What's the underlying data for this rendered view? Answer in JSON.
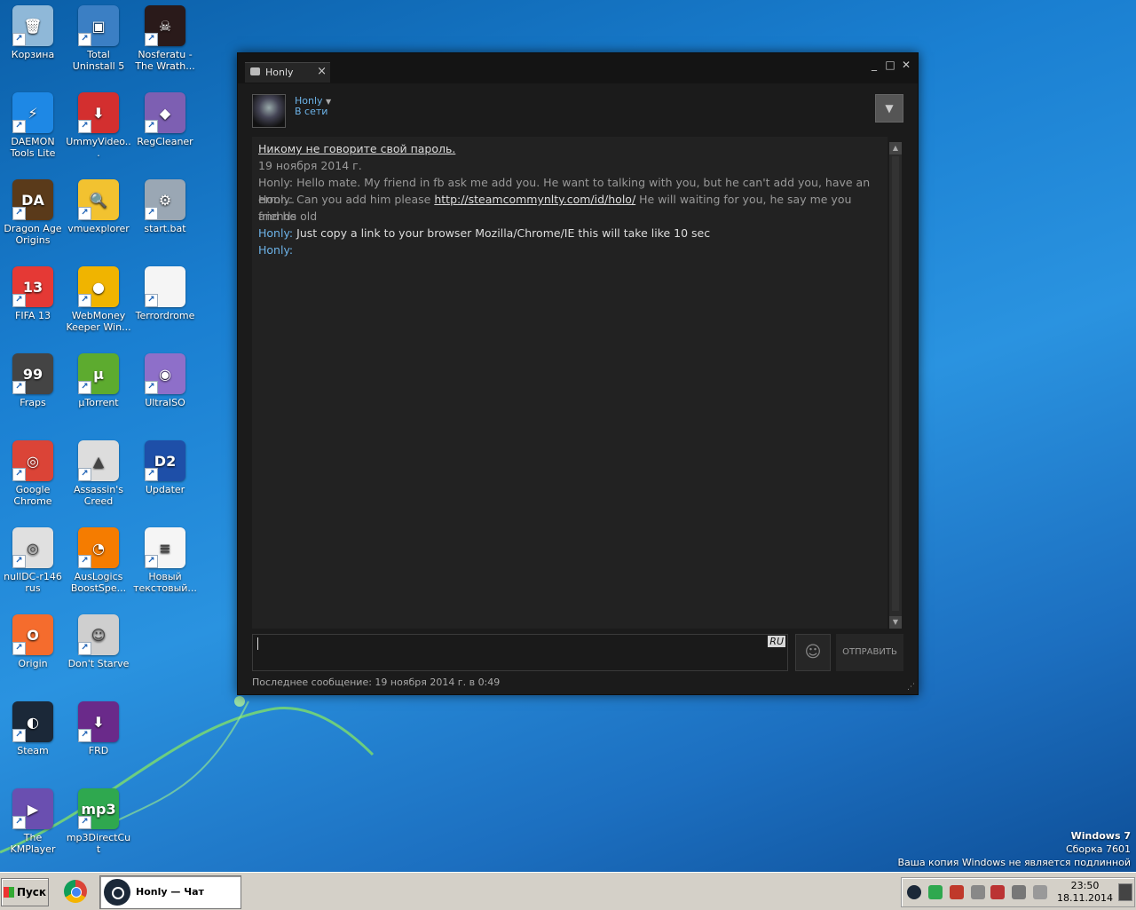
{
  "desktop": {
    "icons": [
      {
        "label": "Корзина",
        "icon": "recycle-bin-icon",
        "color": "#8fb8d8",
        "glyph": "🗑"
      },
      {
        "label": "Total Uninstall 5",
        "icon": "total-uninstall-icon",
        "color": "#3b7fc4",
        "glyph": "▣"
      },
      {
        "label": "Nosferatu - The Wrath...",
        "icon": "nosferatu-icon",
        "color": "#2a1a1a",
        "glyph": "☠"
      },
      {
        "label": "DAEMON Tools Lite",
        "icon": "daemon-tools-icon",
        "color": "#1e88e5",
        "glyph": "⚡"
      },
      {
        "label": "UmmyVideo...",
        "icon": "ummy-video-icon",
        "color": "#d32f2f",
        "glyph": "⬇"
      },
      {
        "label": "RegCleaner",
        "icon": "regcleaner-icon",
        "color": "#7d5fb2",
        "glyph": "◆"
      },
      {
        "label": "Dragon Age Origins",
        "icon": "dragon-age-icon",
        "color": "#5a3a1a",
        "glyph": "DA"
      },
      {
        "label": "vmuexplorer",
        "icon": "vmuexplorer-icon",
        "color": "#f2c230",
        "glyph": "🔍"
      },
      {
        "label": "start.bat",
        "icon": "bat-file-icon",
        "color": "#9aa7b4",
        "glyph": "⚙"
      },
      {
        "label": "FIFA 13",
        "icon": "fifa13-icon",
        "color": "#e53935",
        "glyph": "13"
      },
      {
        "label": "WebMoney Keeper Win...",
        "icon": "webmoney-icon",
        "color": "#f0b400",
        "glyph": "●"
      },
      {
        "label": "Terrordrome",
        "icon": "blank-file-icon",
        "color": "#f5f5f5",
        "glyph": ""
      },
      {
        "label": "Fraps",
        "icon": "fraps-icon",
        "color": "#444444",
        "glyph": "99"
      },
      {
        "label": "µTorrent",
        "icon": "utorrent-icon",
        "color": "#5dab2f",
        "glyph": "µ"
      },
      {
        "label": "UltraISO",
        "icon": "ultraiso-icon",
        "color": "#8e6fc9",
        "glyph": "◉"
      },
      {
        "label": "Google Chrome",
        "icon": "chrome-icon",
        "color": "#db4437",
        "glyph": "◎"
      },
      {
        "label": "Assassin's Creed",
        "icon": "assassins-creed-icon",
        "color": "#dddddd",
        "glyph": "▲"
      },
      {
        "label": "Updater",
        "icon": "d2-updater-icon",
        "color": "#1e4fa8",
        "glyph": "D2"
      },
      {
        "label": "nullDC-r146 rus",
        "icon": "nulldc-icon",
        "color": "#e0e0e0",
        "glyph": "◎"
      },
      {
        "label": "AusLogics BoostSpe...",
        "icon": "auslogics-icon",
        "color": "#f57c00",
        "glyph": "◔"
      },
      {
        "label": "Новый текстовый...",
        "icon": "text-file-icon",
        "color": "#f5f5f5",
        "glyph": "≡"
      },
      {
        "label": "Origin",
        "icon": "origin-icon",
        "color": "#f56c2d",
        "glyph": "O"
      },
      {
        "label": "Don't Starve",
        "icon": "dont-starve-icon",
        "color": "#cfcfcf",
        "glyph": "☺"
      },
      {
        "label": "",
        "icon": "empty-slot",
        "color": "",
        "glyph": ""
      },
      {
        "label": "Steam",
        "icon": "steam-icon",
        "color": "#1b2838",
        "glyph": "◐"
      },
      {
        "label": "FRD",
        "icon": "frd-icon",
        "color": "#6a2a8a",
        "glyph": "⬇"
      },
      {
        "label": "",
        "icon": "empty-slot",
        "color": "",
        "glyph": ""
      },
      {
        "label": "The KMPlayer",
        "icon": "kmplayer-icon",
        "color": "#6a4fb0",
        "glyph": "▶"
      },
      {
        "label": "mp3DirectCut",
        "icon": "mp3directcut-icon",
        "color": "#2fa84f",
        "glyph": "mp3"
      }
    ],
    "watermark": {
      "line1": "Windows 7",
      "line2": "Сборка 7601",
      "line3": "Ваша копия Windows не является подлинной"
    }
  },
  "chat": {
    "tab_label": "Honly",
    "tab_close": "×",
    "window_buttons": {
      "minimize": "_",
      "maximize": "□",
      "close": "✕"
    },
    "user": {
      "name": "Honly",
      "status": "В сети"
    },
    "messages": {
      "warning": "Никому не говорите свой пароль.",
      "date": "19 ноября 2014 г.",
      "m1_name": "Honly:",
      "m1_text": " Hello mate. My friend in fb ask me add you. He want to talking with you, but he can't add you, have an error...",
      "m2_name": "Honly:",
      "m2_pre": "  Can you add him please ",
      "m2_link": "http://steamcommynlty.com/id/holo/",
      "m2_post": " He will waiting for you, he say me you and he old",
      "m2_cont": "friends",
      "m3_name": "Honly:",
      "m3_text": " Just copy a link to your browser Mozilla/Chrome/IE this will take like 10 sec",
      "m4_name": "Honly:"
    },
    "input": {
      "value": "",
      "lang": "RU"
    },
    "send_label": "ОТПРАВИТЬ",
    "footer": "Последнее сообщение: 19 ноября 2014 г. в 0:49"
  },
  "taskbar": {
    "start_label": "Пуск",
    "active_task": "Honly — Чат",
    "clock_time": "23:50",
    "clock_date": "18.11.2014"
  },
  "colors": {
    "desktop_blue": "#1a7fd1",
    "chat_bg": "#1b1b1b",
    "steam_name_blue": "#6db3e8"
  }
}
